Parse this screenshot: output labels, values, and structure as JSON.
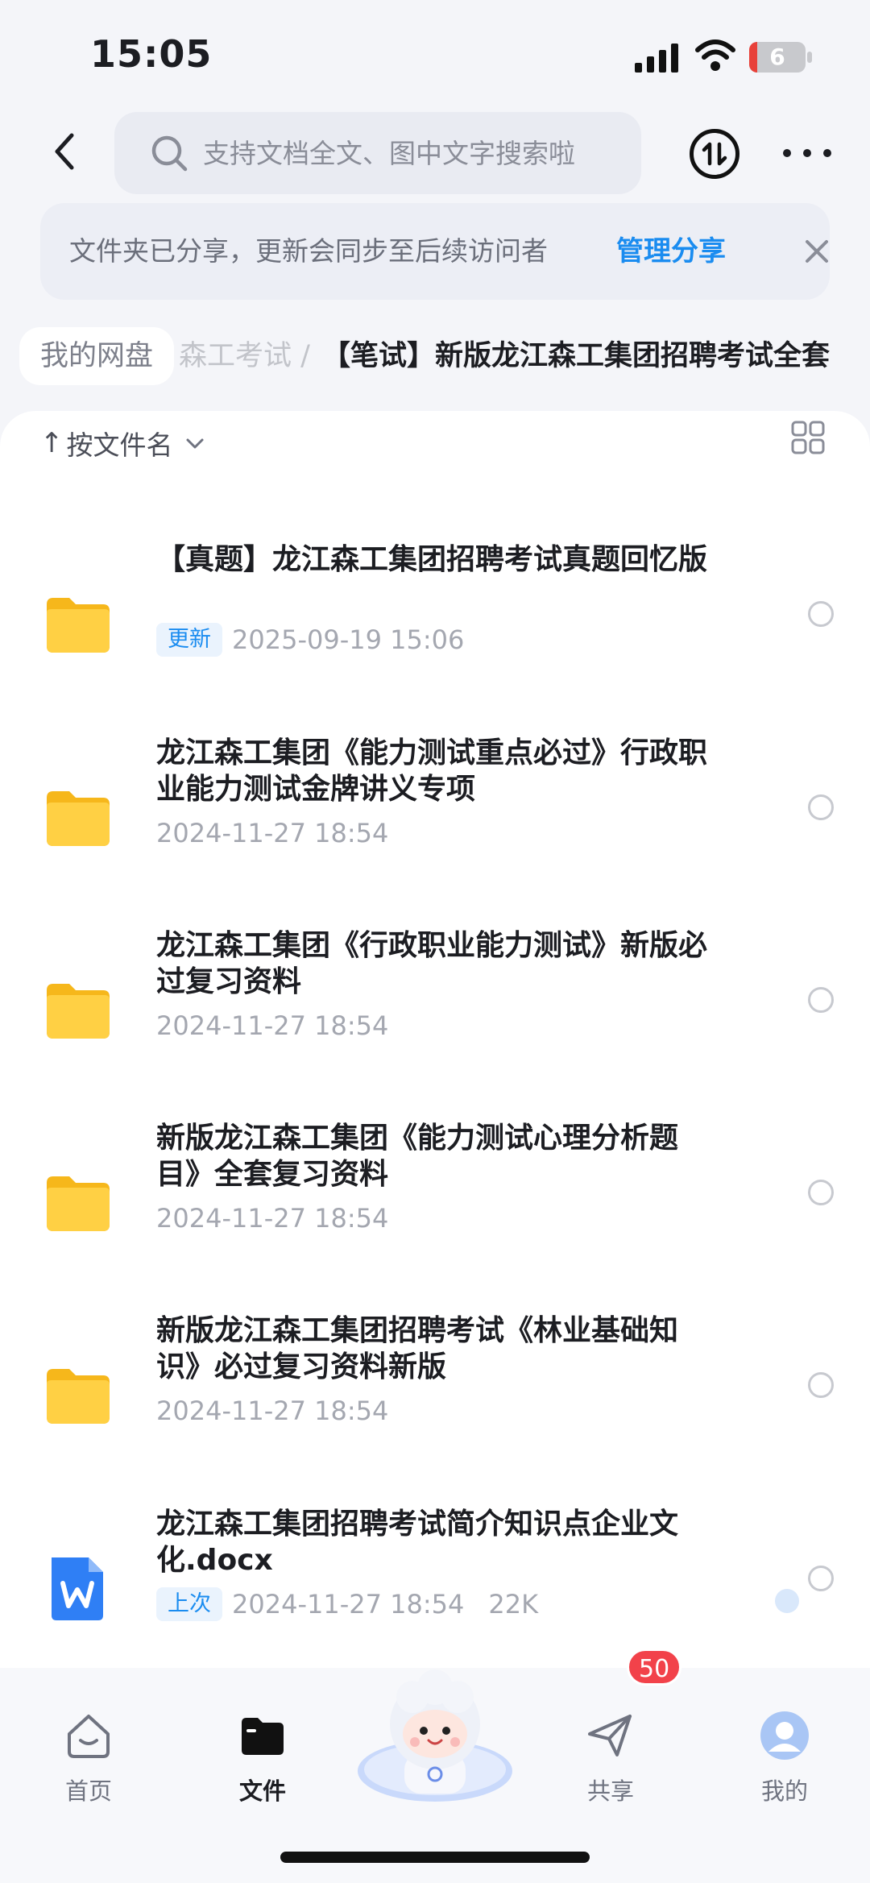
{
  "status_bar": {
    "time": "15:05",
    "battery": "6"
  },
  "header": {
    "search_placeholder": "支持文档全文、图中文字搜索啦"
  },
  "share_banner": {
    "text": "文件夹已分享，更新会同步至后续访问者",
    "manage_label": "管理分享"
  },
  "breadcrumb": {
    "root": "我的网盘",
    "trail": "森工考试 /",
    "current": "【笔试】新版龙江森工集团招聘考试全套"
  },
  "list_toolbar": {
    "sort_arrow": "↑",
    "sort_label": "按文件名"
  },
  "files": [
    {
      "name": "【真题】龙江森工集团招聘考试真题回忆版",
      "tag": "更新",
      "date": "2025-09-19 15:06",
      "size": "",
      "type": "folder"
    },
    {
      "name": "龙江森工集团《能力测试重点必过》行政职业能力测试金牌讲义专项",
      "tag": "",
      "date": "2024-11-27 18:54",
      "size": "",
      "type": "folder"
    },
    {
      "name": "龙江森工集团《行政职业能力测试》新版必过复习资料",
      "tag": "",
      "date": "2024-11-27 18:54",
      "size": "",
      "type": "folder"
    },
    {
      "name": "新版龙江森工集团《能力测试心理分析题目》全套复习资料",
      "tag": "",
      "date": "2024-11-27 18:54",
      "size": "",
      "type": "folder"
    },
    {
      "name": "新版龙江森工集团招聘考试《林业基础知识》必过复习资料新版",
      "tag": "",
      "date": "2024-11-27 18:54",
      "size": "",
      "type": "folder"
    },
    {
      "name": "龙江森工集团招聘考试简介知识点企业文化.docx",
      "tag": "上次",
      "date": "2024-11-27 18:54",
      "size": "22K",
      "type": "word"
    }
  ],
  "tabbar": {
    "home": "首页",
    "files": "文件",
    "share": "共享",
    "share_badge": "50",
    "mine": "我的"
  },
  "colors": {
    "accent": "#1a8cf0",
    "folder": "#fbc531",
    "badge": "#f2424a",
    "word_icon": "#2f7ff5"
  }
}
